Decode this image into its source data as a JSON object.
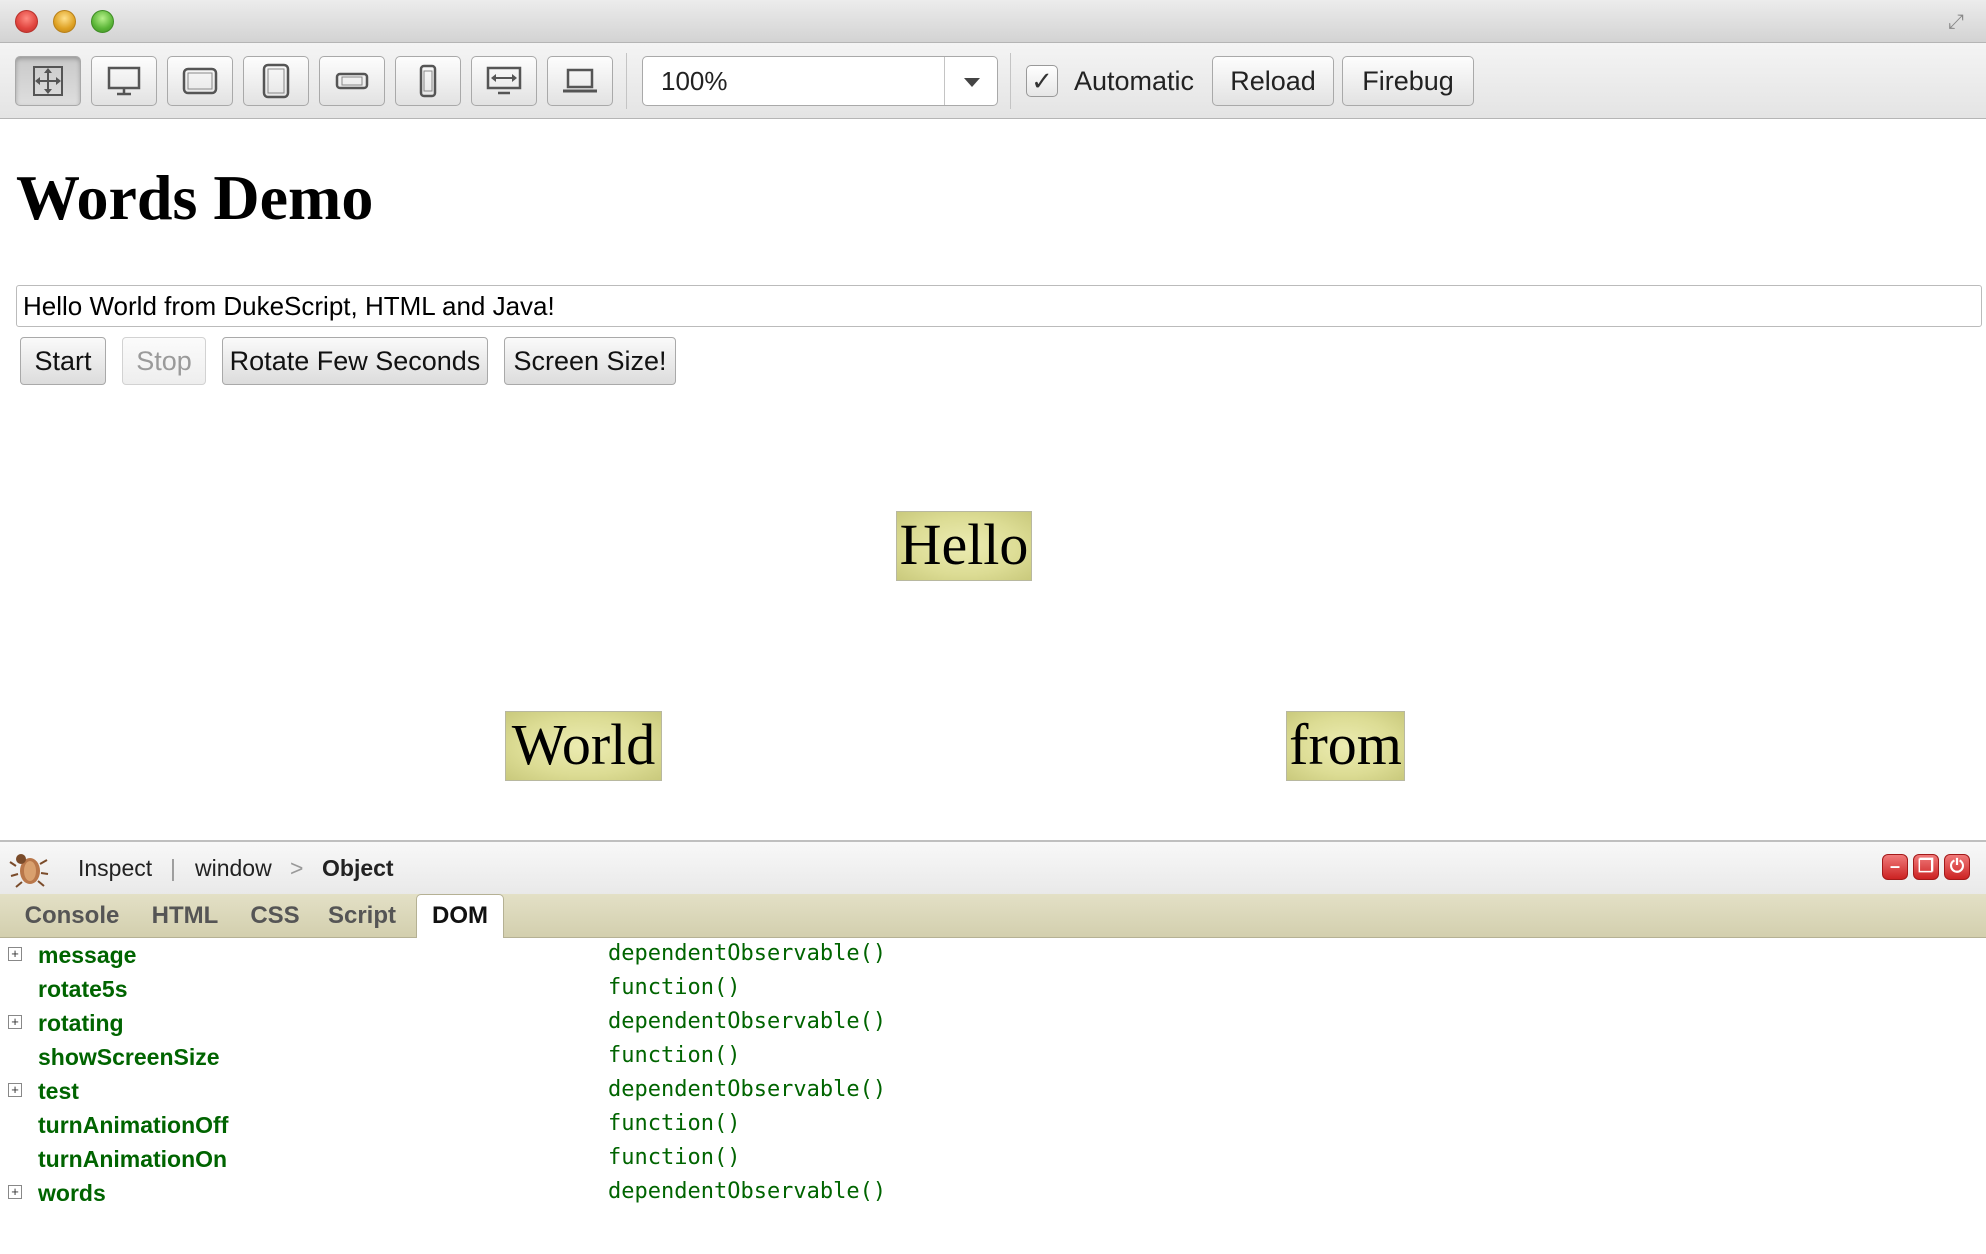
{
  "window": {
    "traffic_lights": [
      "close",
      "minimize",
      "zoom"
    ]
  },
  "toolbar": {
    "device_buttons": [
      {
        "icon": "move-arrows-icon",
        "active": true
      },
      {
        "icon": "desktop-monitor-icon",
        "active": false
      },
      {
        "icon": "tablet-landscape-icon",
        "active": false
      },
      {
        "icon": "tablet-portrait-icon",
        "active": false
      },
      {
        "icon": "phone-landscape-icon",
        "active": false
      },
      {
        "icon": "phone-portrait-icon",
        "active": false
      },
      {
        "icon": "widescreen-icon",
        "active": false
      },
      {
        "icon": "laptop-icon",
        "active": false
      }
    ],
    "zoom_value": "100%",
    "automatic_label": "Automatic",
    "automatic_checked": true,
    "reload_label": "Reload",
    "firebug_label": "Firebug"
  },
  "page": {
    "title": "Words Demo",
    "message_value": "Hello World from DukeScript, HTML and Java!",
    "buttons": {
      "start": "Start",
      "stop": "Stop",
      "rotate": "Rotate Few Seconds",
      "screen_size": "Screen Size!"
    },
    "words": [
      "Hello",
      "World",
      "from"
    ],
    "word_color": "#dcdc94"
  },
  "firebug": {
    "inspect_label": "Inspect",
    "breadcrumb": [
      "window",
      "Object"
    ],
    "breadcrumb_separator": ">",
    "tabs": [
      {
        "label": "Console",
        "active": false
      },
      {
        "label": "HTML",
        "active": false
      },
      {
        "label": "CSS",
        "active": false
      },
      {
        "label": "Script",
        "active": false
      },
      {
        "label": "DOM",
        "active": true
      }
    ],
    "dom_rows": [
      {
        "key": "message",
        "value": "dependentObservable()",
        "expandable": true
      },
      {
        "key": "rotate5s",
        "value": "function()",
        "expandable": false
      },
      {
        "key": "rotating",
        "value": "dependentObservable()",
        "expandable": true
      },
      {
        "key": "showScreenSize",
        "value": "function()",
        "expandable": false
      },
      {
        "key": "test",
        "value": "dependentObservable()",
        "expandable": true
      },
      {
        "key": "turnAnimationOff",
        "value": "function()",
        "expandable": false
      },
      {
        "key": "turnAnimationOn",
        "value": "function()",
        "expandable": false
      },
      {
        "key": "words",
        "value": "dependentObservable()",
        "expandable": true
      }
    ],
    "value_color": "#006400"
  }
}
